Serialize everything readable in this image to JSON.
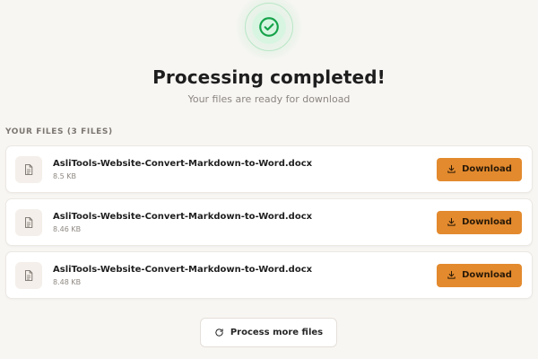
{
  "header": {
    "title": "Processing completed!",
    "subtitle": "Your files are ready for download",
    "status_icon": "check-circle-icon",
    "status_color": "#22c55e"
  },
  "files_section": {
    "label": "YOUR FILES (3 FILES)",
    "download_label": "Download",
    "files": [
      {
        "name": "AsliTools-Website-Convert-Markdown-to-Word.docx",
        "size": "8.5 KB"
      },
      {
        "name": "AsliTools-Website-Convert-Markdown-to-Word.docx",
        "size": "8.46 KB"
      },
      {
        "name": "AsliTools-Website-Convert-Markdown-to-Word.docx",
        "size": "8.48 KB"
      }
    ]
  },
  "actions": {
    "process_more_label": "Process more files"
  },
  "colors": {
    "accent": "#e38a2e",
    "background": "#f8f6f3"
  }
}
